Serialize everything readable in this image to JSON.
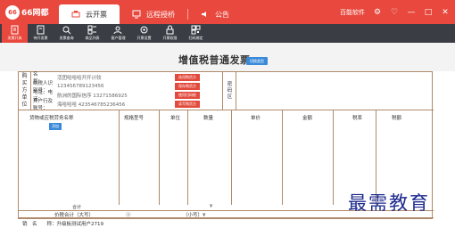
{
  "app": {
    "logo_mark": "66",
    "logo_text": "66网都",
    "brand_color": "#e8483d",
    "toolbar_color": "#3a3d44",
    "accent": "#3b8ad9"
  },
  "tabs": [
    {
      "label": "云开票"
    },
    {
      "label": "远程授桥"
    },
    {
      "label": "公告"
    }
  ],
  "window": {
    "brand": "百能软件",
    "controls": [
      "settings-icon",
      "chat-icon",
      "minimize-icon",
      "maximize-icon",
      "close-icon"
    ]
  },
  "toolbar": [
    {
      "label": "发票开具",
      "icon": "invoice-icon"
    },
    {
      "label": "待开发票",
      "icon": "pending-icon"
    },
    {
      "label": "发票查询",
      "icon": "search-icon"
    },
    {
      "label": "商品列表",
      "icon": "goods-icon"
    },
    {
      "label": "客户管理",
      "icon": "customer-icon"
    },
    {
      "label": "开票设置",
      "icon": "gear-icon"
    },
    {
      "label": "开票权限",
      "icon": "lock-icon"
    },
    {
      "label": "扫码绑定",
      "icon": "qr-icon"
    }
  ],
  "invoice": {
    "title": "增值税普通发票",
    "switch_label": "切换类型",
    "buyer_label": [
      "购",
      "买",
      "方",
      "单",
      "位"
    ],
    "fields": [
      {
        "label": "名　　称：",
        "value": "活团哈哈哈开开计较",
        "btn": "选用购货方",
        "btn_color": "#e24a3c"
      },
      {
        "label": "纳税人识别号：",
        "value": "123456789123456",
        "btn": "保存购货方",
        "btn_color": "#e24a3c"
      },
      {
        "label": "地址、电话：",
        "value": "航洲的国际信序 13271586925",
        "btn": "使用扫码枪",
        "btn_color": "#e24a3c"
      },
      {
        "label": "开户行及账号：",
        "value": "海哈哈哈 423546785236456",
        "btn": "读写购货方",
        "btn_color": "#e24a3c"
      }
    ],
    "pwd_label": [
      "密",
      "码",
      "区"
    ],
    "columns": [
      "货物或应税劳务名称",
      "规格型号",
      "单位",
      "数量",
      "单价",
      "金额",
      "税率",
      "税额"
    ],
    "add_label": "添加",
    "total_label": "合计",
    "total_yen": "¥",
    "sum_label": "价税合计（大写）",
    "sum_circle": "ⓧ",
    "sum_small": "（小写）¥",
    "seller_label": "销",
    "seller_name_label": "名　　称：",
    "seller_name": "升级板测试用户2719"
  },
  "watermark": "最需教育"
}
